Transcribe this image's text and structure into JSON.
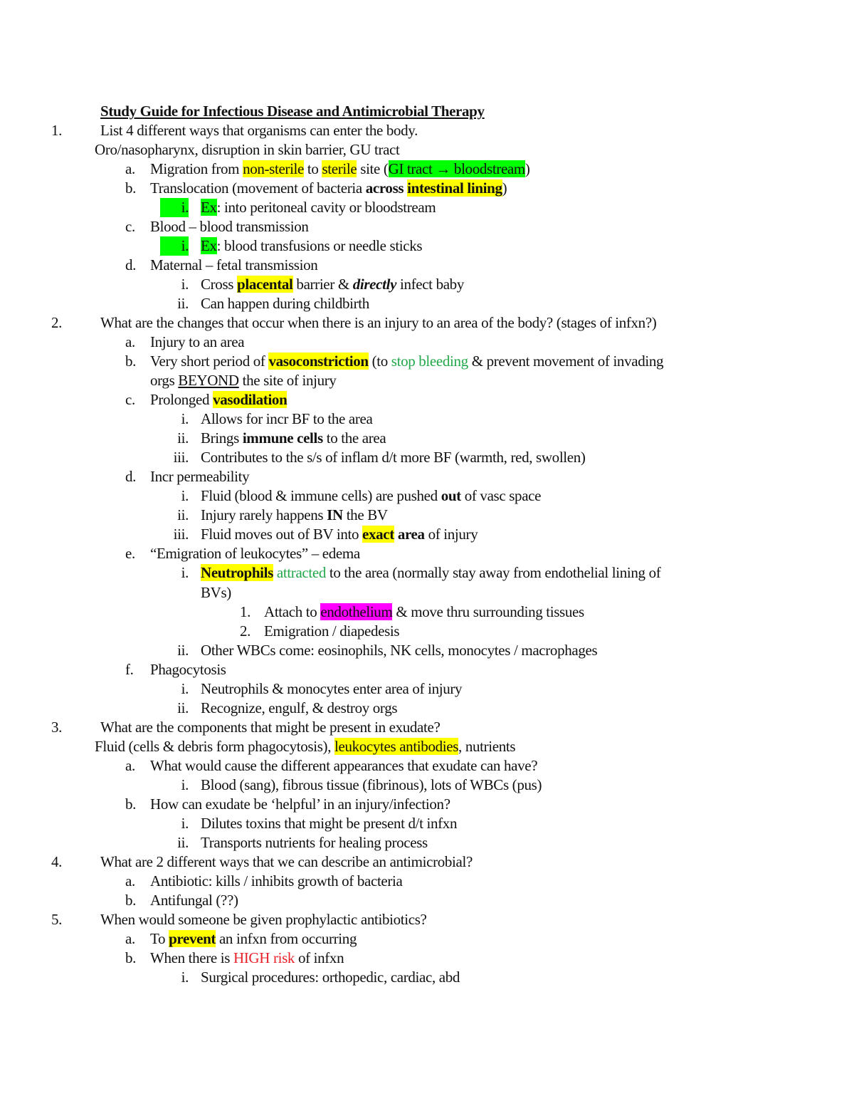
{
  "colors": {
    "yellow": "#ffff00",
    "green": "#00ff00",
    "magenta": "#ff00ff",
    "text_green": "#22a84a",
    "text_red": "#e8212a"
  },
  "lines": [
    {
      "lvl": "t",
      "m": "",
      "s": [
        {
          "t": "Study Guide for Infectious Disease and Antimicrobial Therapy"
        }
      ]
    },
    {
      "lvl": "n",
      "m": "1.",
      "s": [
        {
          "t": "List 4 different ways that organisms can enter the body."
        }
      ]
    },
    {
      "lvl": "p",
      "m": "",
      "s": [
        {
          "t": "Oro/nasopharynx, disruption in skin barrier, GU tract"
        }
      ]
    },
    {
      "lvl": "a",
      "m": "a.",
      "s": [
        {
          "t": "Migration from "
        },
        {
          "t": "non-sterile",
          "hl": "yellow"
        },
        {
          "t": " to "
        },
        {
          "t": "sterile",
          "hl": "yellow"
        },
        {
          "t": " site ("
        },
        {
          "t": "GI tract → bloodstream",
          "hl": "green"
        },
        {
          "t": ")"
        }
      ]
    },
    {
      "lvl": "a",
      "m": "b.",
      "s": [
        {
          "t": "Translocation (movement of bacteria "
        },
        {
          "t": "across",
          "b": true
        },
        {
          "t": " "
        },
        {
          "t": "intestinal lining",
          "b": true,
          "hl": "yellow"
        },
        {
          "t": ")"
        }
      ]
    },
    {
      "lvl": "i",
      "m": "i.",
      "mhl": "green",
      "s": [
        {
          "t": "Ex",
          "hl": "green"
        },
        {
          "t": ": into peritoneal cavity or bloodstream"
        }
      ]
    },
    {
      "lvl": "a",
      "m": "c.",
      "s": [
        {
          "t": "Blood – blood transmission"
        }
      ]
    },
    {
      "lvl": "i",
      "m": "i.",
      "mhl": "green",
      "s": [
        {
          "t": "Ex",
          "hl": "green"
        },
        {
          "t": ": blood transfusions or needle sticks"
        }
      ]
    },
    {
      "lvl": "a",
      "m": "d.",
      "s": [
        {
          "t": "Maternal – fetal transmission"
        }
      ]
    },
    {
      "lvl": "i",
      "m": "i.",
      "s": [
        {
          "t": "Cross "
        },
        {
          "t": "placental",
          "b": true,
          "hl": "yellow"
        },
        {
          "t": " barrier & "
        },
        {
          "t": "directly",
          "b": true,
          "i": true
        },
        {
          "t": " infect baby"
        }
      ]
    },
    {
      "lvl": "i",
      "m": "ii.",
      "s": [
        {
          "t": "Can happen during childbirth"
        }
      ]
    },
    {
      "lvl": "n",
      "m": "2.",
      "s": [
        {
          "t": "What are the changes that occur when there is an injury to an area of the body? (stages of infxn?)"
        }
      ]
    },
    {
      "lvl": "a",
      "m": "a.",
      "s": [
        {
          "t": "Injury to an area"
        }
      ]
    },
    {
      "lvl": "a",
      "m": "b.",
      "s": [
        {
          "t": "Very short period of "
        },
        {
          "t": "vasoconstriction",
          "b": true,
          "hl": "yellow"
        },
        {
          "t": " (to "
        },
        {
          "t": "stop bleeding",
          "c": "text_green"
        },
        {
          "t": " & prevent movement of invading"
        }
      ]
    },
    {
      "lvl": "ac",
      "m": "",
      "s": [
        {
          "t": "orgs "
        },
        {
          "t": "BEYOND",
          "u": true
        },
        {
          "t": " the site of injury"
        }
      ]
    },
    {
      "lvl": "a",
      "m": "c.",
      "s": [
        {
          "t": "Prolonged "
        },
        {
          "t": "vasodilation",
          "b": true,
          "hl": "yellow"
        }
      ]
    },
    {
      "lvl": "i",
      "m": "i.",
      "s": [
        {
          "t": "Allows for incr BF to the area"
        }
      ]
    },
    {
      "lvl": "i",
      "m": "ii.",
      "s": [
        {
          "t": "Brings "
        },
        {
          "t": "immune cells",
          "b": true
        },
        {
          "t": " to the area"
        }
      ]
    },
    {
      "lvl": "i",
      "m": "iii.",
      "s": [
        {
          "t": "Contributes to the s/s of inflam d/t more BF (warmth, red, swollen)"
        }
      ]
    },
    {
      "lvl": "a",
      "m": "d.",
      "s": [
        {
          "t": "Incr permeability"
        }
      ]
    },
    {
      "lvl": "i",
      "m": "i.",
      "s": [
        {
          "t": "Fluid (blood & immune cells) are pushed "
        },
        {
          "t": "out",
          "b": true
        },
        {
          "t": " of vasc space"
        }
      ]
    },
    {
      "lvl": "i",
      "m": "ii.",
      "s": [
        {
          "t": "Injury rarely happens "
        },
        {
          "t": "IN",
          "b": true
        },
        {
          "t": " the BV"
        }
      ]
    },
    {
      "lvl": "i",
      "m": "iii.",
      "s": [
        {
          "t": "Fluid moves out of BV into "
        },
        {
          "t": "exact",
          "b": true,
          "hl": "yellow"
        },
        {
          "t": " "
        },
        {
          "t": "area",
          "b": true
        },
        {
          "t": " of injury"
        }
      ]
    },
    {
      "lvl": "a",
      "m": "e.",
      "s": [
        {
          "t": "“Emigration of leukocytes” – edema"
        }
      ]
    },
    {
      "lvl": "i",
      "m": "i.",
      "s": [
        {
          "t": "Neutrophils",
          "b": true,
          "hl": "yellow"
        },
        {
          "t": " "
        },
        {
          "t": "attracted",
          "c": "text_green"
        },
        {
          "t": " to the area (normally stay away from endothelial lining of"
        }
      ]
    },
    {
      "lvl": "ic",
      "m": "",
      "s": [
        {
          "t": "BVs)"
        }
      ]
    },
    {
      "lvl": "s",
      "m": "1.",
      "s": [
        {
          "t": "Attach to "
        },
        {
          "t": "endothelium",
          "hl": "magenta"
        },
        {
          "t": " & move thru surrounding tissues"
        }
      ]
    },
    {
      "lvl": "s",
      "m": "2.",
      "s": [
        {
          "t": "Emigration / diapedesis"
        }
      ]
    },
    {
      "lvl": "i",
      "m": "ii.",
      "s": [
        {
          "t": "Other WBCs come: eosinophils, NK cells, monocytes / macrophages"
        }
      ]
    },
    {
      "lvl": "a",
      "m": "f.",
      "s": [
        {
          "t": "Phagocytosis"
        }
      ]
    },
    {
      "lvl": "i",
      "m": "i.",
      "s": [
        {
          "t": "Neutrophils & monocytes enter area of injury"
        }
      ]
    },
    {
      "lvl": "i",
      "m": "ii.",
      "s": [
        {
          "t": "Recognize, engulf, & destroy orgs"
        }
      ]
    },
    {
      "lvl": "n",
      "m": "3.",
      "s": [
        {
          "t": "What are the components that might be present in exudate?"
        }
      ]
    },
    {
      "lvl": "p",
      "m": "",
      "s": [
        {
          "t": "Fluid (cells & debris form phagocytosis), "
        },
        {
          "t": "leukocytes antibodies",
          "hl": "yellow"
        },
        {
          "t": ", nutrients"
        }
      ]
    },
    {
      "lvl": "a",
      "m": "a.",
      "s": [
        {
          "t": "What would cause the different appearances that exudate can have?"
        }
      ]
    },
    {
      "lvl": "i",
      "m": "i.",
      "s": [
        {
          "t": "Blood (sang), fibrous tissue (fibrinous), lots of WBCs (pus)"
        }
      ]
    },
    {
      "lvl": "a",
      "m": "b.",
      "s": [
        {
          "t": "How can exudate be ‘helpful’ in an injury/infection?"
        }
      ]
    },
    {
      "lvl": "i",
      "m": "i.",
      "s": [
        {
          "t": "Dilutes toxins that might be present d/t infxn"
        }
      ]
    },
    {
      "lvl": "i",
      "m": "ii.",
      "s": [
        {
          "t": "Transports nutrients for healing process"
        }
      ]
    },
    {
      "lvl": "n",
      "m": "4.",
      "s": [
        {
          "t": "What are 2 different ways that we can describe an antimicrobial?"
        }
      ]
    },
    {
      "lvl": "a",
      "m": "a.",
      "s": [
        {
          "t": "Antibiotic: kills / inhibits growth of bacteria"
        }
      ]
    },
    {
      "lvl": "a",
      "m": "b.",
      "s": [
        {
          "t": "Antifungal (??)"
        }
      ]
    },
    {
      "lvl": "n",
      "m": "5.",
      "s": [
        {
          "t": "When would someone be given prophylactic antibiotics?"
        }
      ]
    },
    {
      "lvl": "a",
      "m": "a.",
      "s": [
        {
          "t": "To "
        },
        {
          "t": "prevent",
          "b": true,
          "hl": "yellow"
        },
        {
          "t": " an infxn from occurring"
        }
      ]
    },
    {
      "lvl": "a",
      "m": "b.",
      "s": [
        {
          "t": "When there is "
        },
        {
          "t": "HIGH risk",
          "c": "text_red"
        },
        {
          "t": " of infxn"
        }
      ]
    },
    {
      "lvl": "i",
      "m": "i.",
      "s": [
        {
          "t": "Surgical procedures: orthopedic, cardiac, abd"
        }
      ]
    }
  ]
}
